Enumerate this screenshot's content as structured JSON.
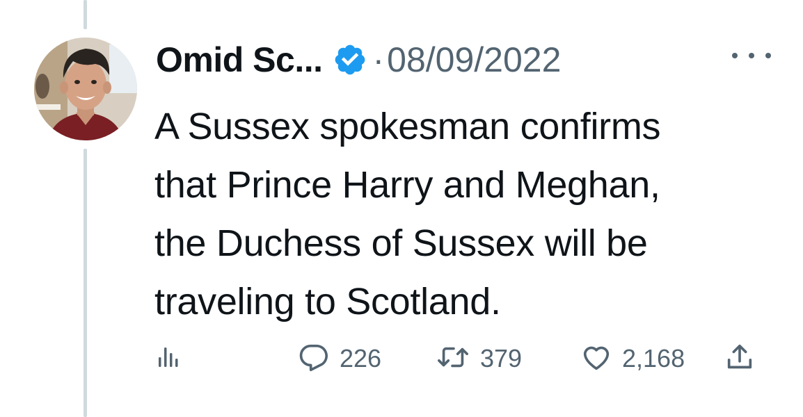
{
  "tweet": {
    "author_name": "Omid Sc...",
    "separator": "·",
    "date": "08/09/2022",
    "text": "A Sussex spokesman confirms\nthat Prince Harry and Meghan,\nthe Duchess of Sussex will be\ntraveling to Scotland.",
    "icons": {
      "verified": "verified-badge-icon",
      "more": "more-options-icon",
      "views": "analytics-icon",
      "reply": "reply-icon",
      "retweet": "retweet-icon",
      "like": "like-icon",
      "share": "share-icon"
    },
    "stats": {
      "replies": "226",
      "retweets": "379",
      "likes": "2,168"
    }
  },
  "colors": {
    "verified_blue": "#1d9bf0",
    "secondary_text": "#536471",
    "primary_text": "#0f1419",
    "thread_line": "#cfd9de"
  }
}
